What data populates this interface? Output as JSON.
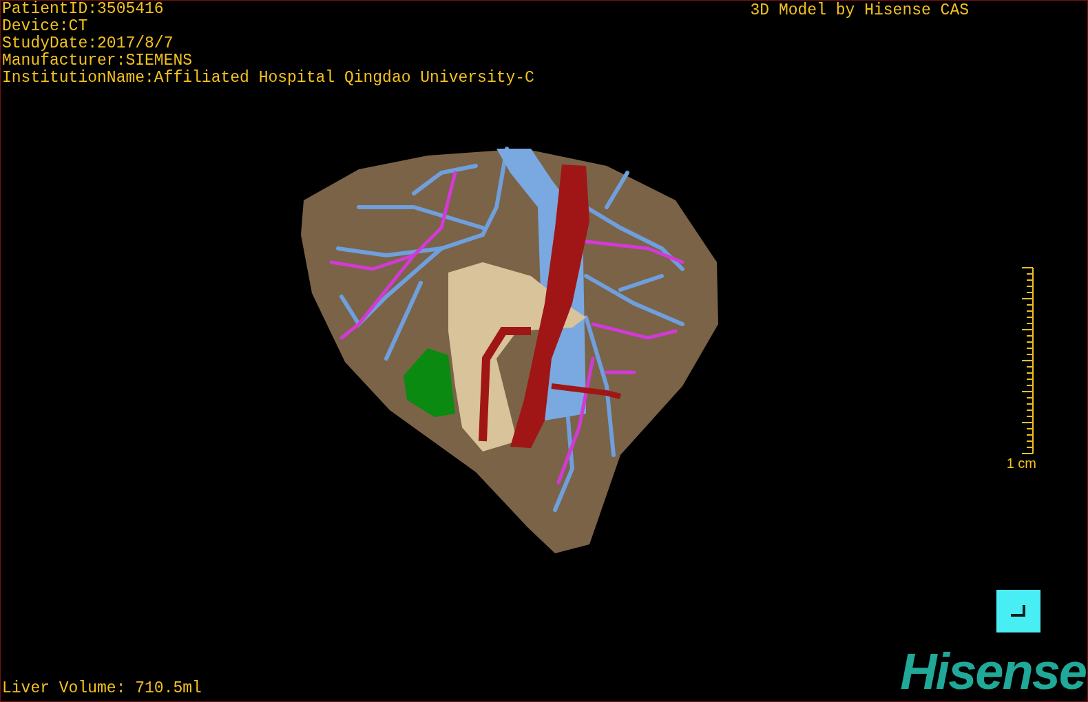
{
  "overlay_info": [
    "PatientID:3505416",
    "Device:CT",
    "StudyDate:2017/8/7",
    "Manufacturer:SIEMENS",
    "InstitutionName:Affiliated Hospital Qingdao University-C"
  ],
  "credit": "3D Model by Hisense CAS",
  "scale_bar": {
    "label": "1 cm"
  },
  "liver_volume": "Liver Volume: 710.5ml",
  "logo": "Hisense"
}
